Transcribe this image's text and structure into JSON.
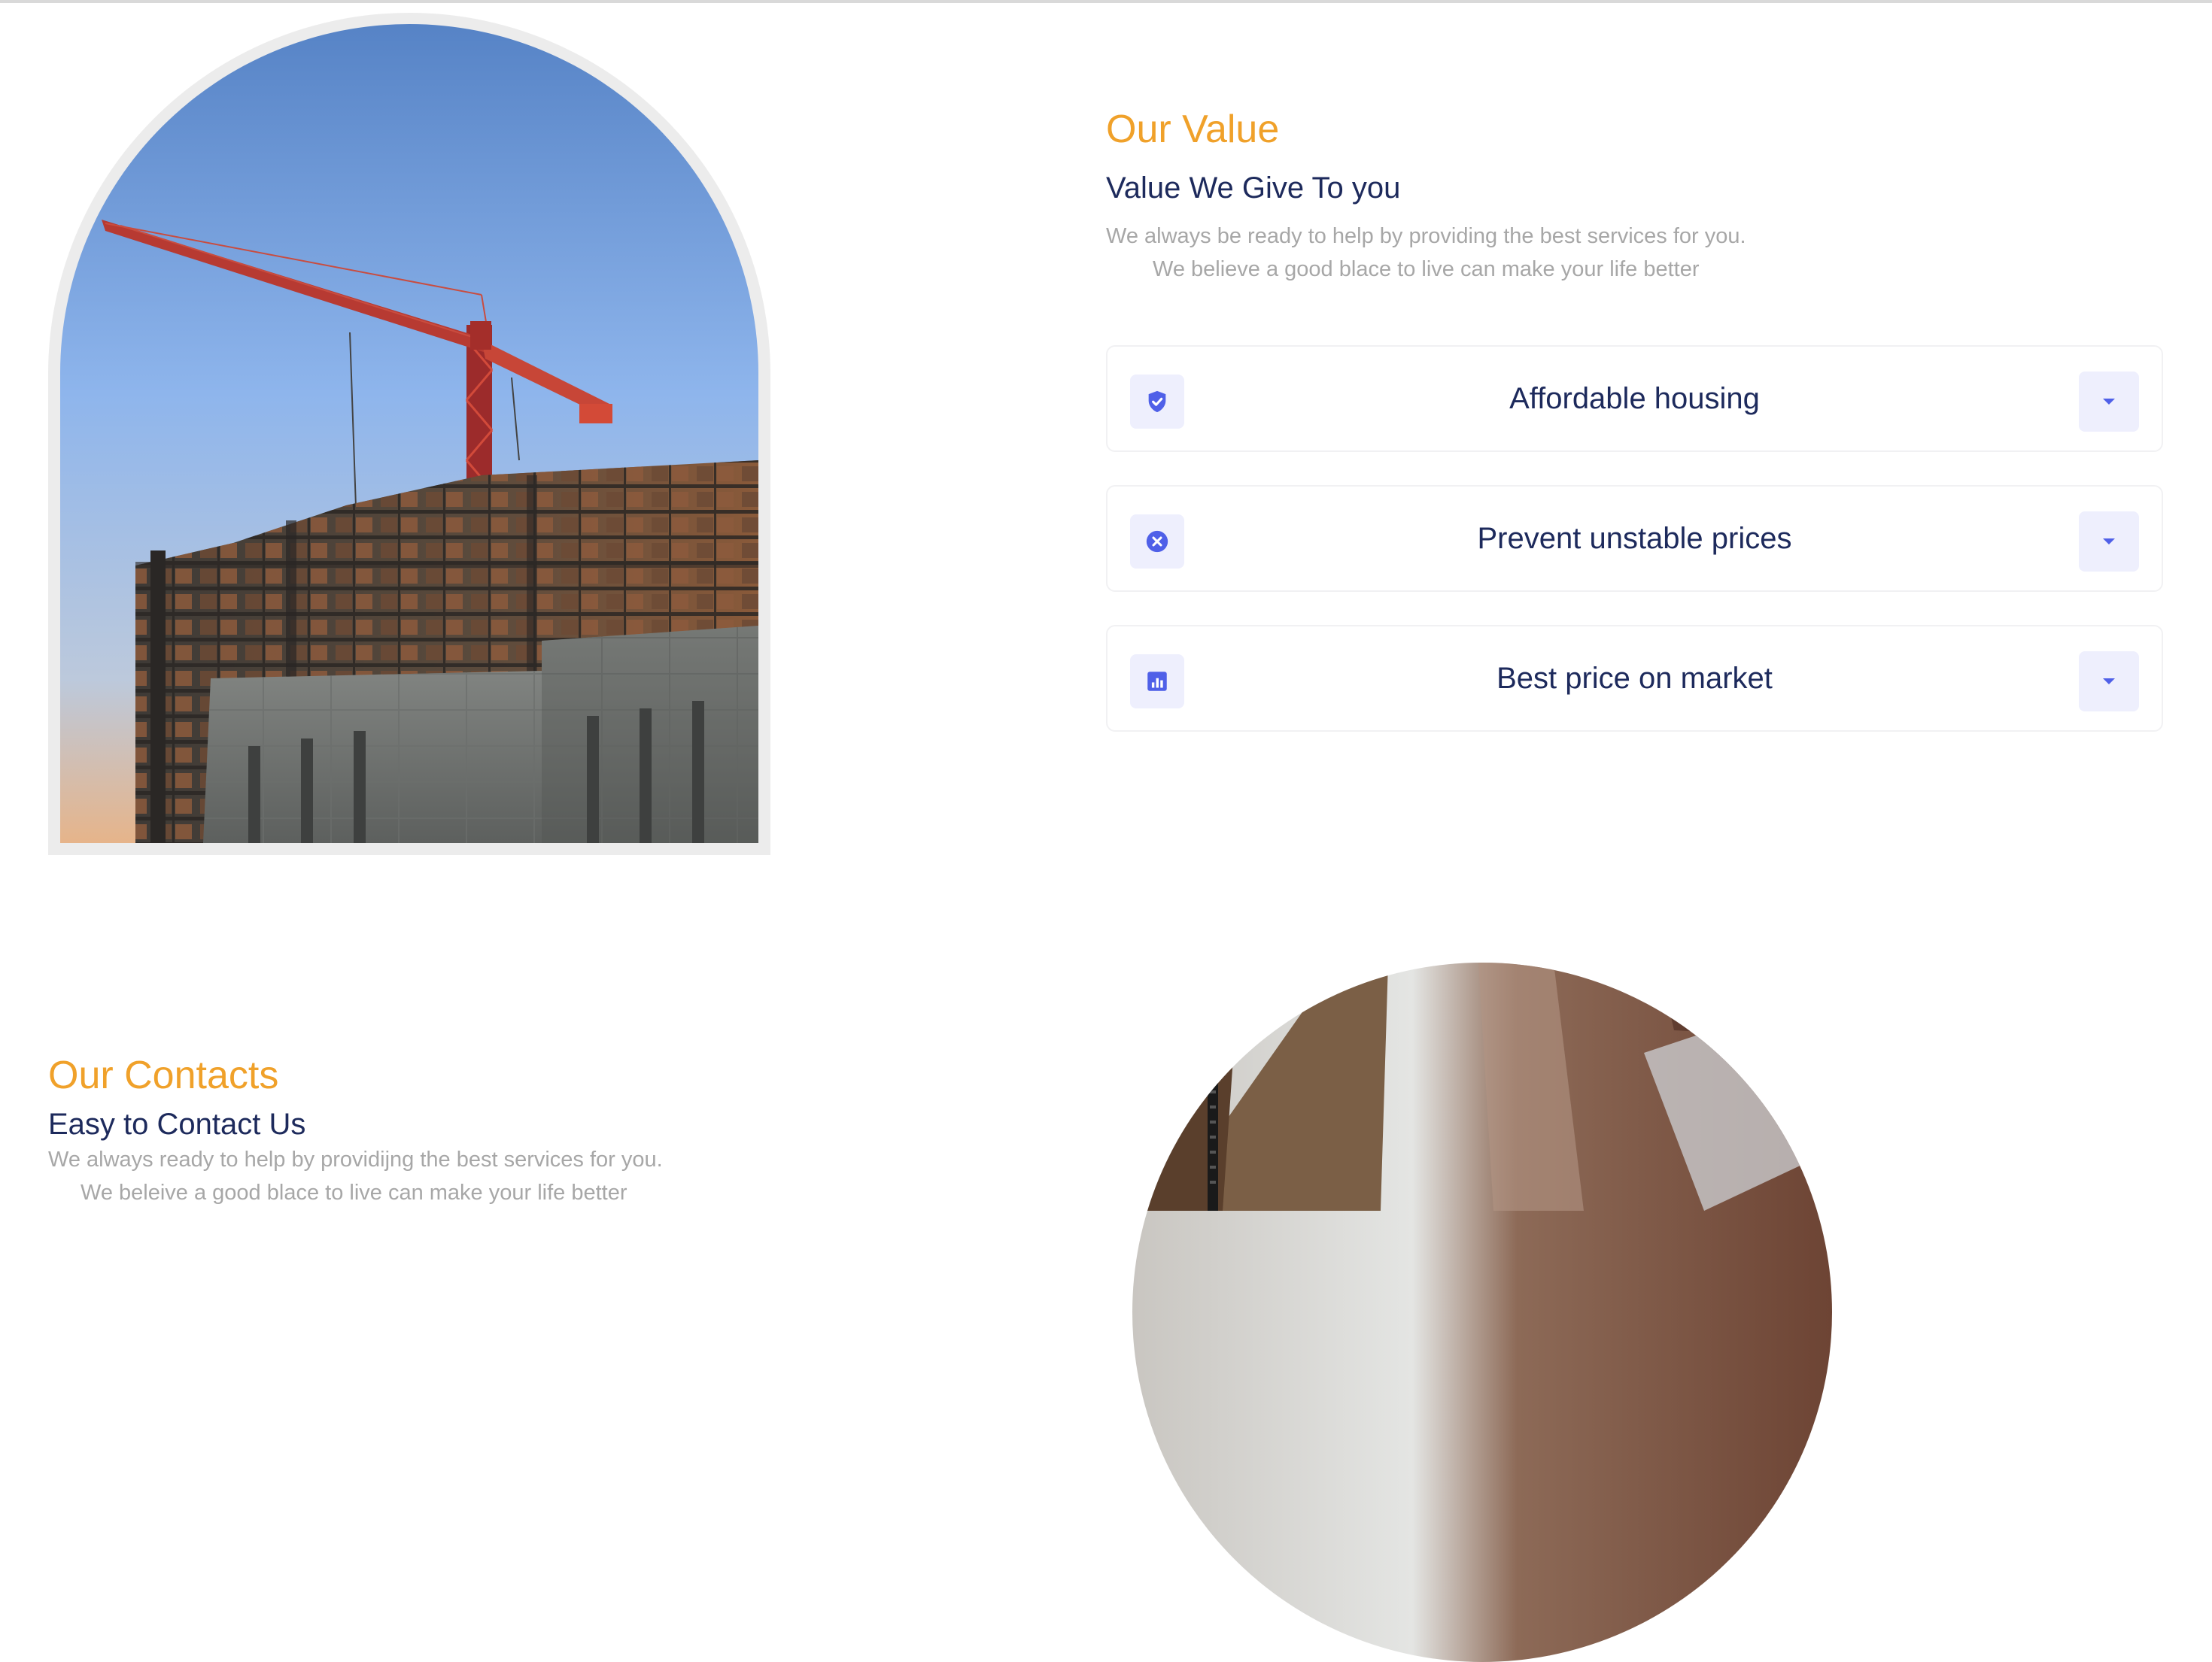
{
  "value_section": {
    "eyebrow": "Our Value",
    "heading": "Value We Give To you",
    "description_line1": "We always be ready to help by providing the best services for you.",
    "description_line2": "We believe a good blace to live can make your life better",
    "image_alt": "Building under construction with a tower crane",
    "items": [
      {
        "icon": "shield-check-icon",
        "title": "Affordable housing",
        "expand_icon": "caret-down-icon"
      },
      {
        "icon": "x-circle-icon",
        "title": "Prevent unstable prices",
        "expand_icon": "caret-down-icon"
      },
      {
        "icon": "bar-chart-icon",
        "title": "Best price on market",
        "expand_icon": "caret-down-icon"
      }
    ]
  },
  "contacts_section": {
    "eyebrow": "Our Contacts",
    "heading": "Easy to Contact Us",
    "description_line1": "We always ready to help by providijng the best services for you.",
    "description_line2": "We beleive a good blace to live can make your life better",
    "image_alt": "Person in a brown jacket"
  },
  "colors": {
    "accent": "#f0a12a",
    "heading": "#1d2a5c",
    "muted_text": "#a7a7a7",
    "icon_blue": "#4f60e8",
    "icon_bg": "#eeeffd"
  }
}
